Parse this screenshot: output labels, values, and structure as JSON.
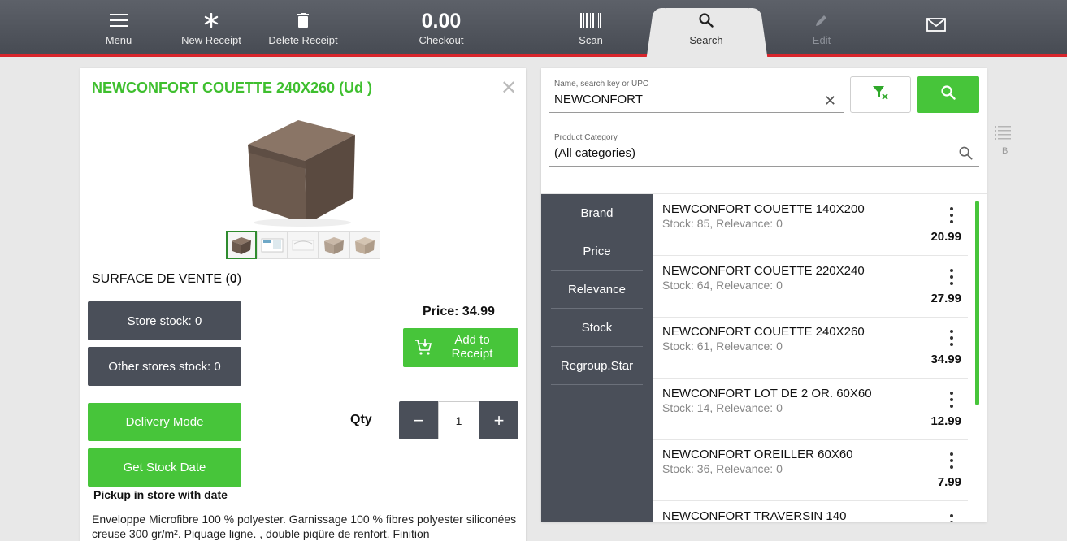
{
  "toolbar": {
    "menu": "Menu",
    "new_receipt": "New Receipt",
    "delete_receipt": "Delete Receipt",
    "checkout_amount": "0.00",
    "checkout": "Checkout",
    "scan": "Scan",
    "search": "Search",
    "edit": "Edit",
    "icons": [
      "menu-icon",
      "asterisk-icon",
      "trash-icon",
      "barcode-icon",
      "search-icon",
      "pencil-icon",
      "mail-icon"
    ],
    "accent_color": "#d8252c"
  },
  "product": {
    "title": "NEWCONFORT COUETTE 240X260 (Ud )",
    "location_label": "SURFACE DE VENTE (",
    "location_count": "0",
    "location_close": ")",
    "store_stock": "Store stock: 0",
    "other_stock": "Other stores stock: 0",
    "price": "Price: 34.99",
    "add_to_receipt": "Add to Receipt",
    "delivery_mode": "Delivery Mode",
    "get_stock_date": "Get Stock Date",
    "pickup_note": "Pickup in store with date",
    "qty_label": "Qty",
    "qty_value": "1",
    "description": "Enveloppe Microfibre 100 % polyester. Garnissage 100 % fibres polyester siliconées creuse 300 gr/m². Piquage ligne. , double piqûre de renfort. Finition",
    "accent_color": "#47c53a"
  },
  "search": {
    "query_label": "Name, search key or UPC",
    "query_value": "NEWCONFORT",
    "category_label": "Product Category",
    "category_value": "(All categories)"
  },
  "sort_options": [
    "Brand",
    "Price",
    "Relevance",
    "Stock",
    "Regroup.Star"
  ],
  "results": [
    {
      "name": "NEWCONFORT COUETTE 140X200",
      "meta": "Stock: 85, Relevance: 0",
      "price": "20.99"
    },
    {
      "name": "NEWCONFORT COUETTE 220X240",
      "meta": "Stock: 64, Relevance: 0",
      "price": "27.99"
    },
    {
      "name": "NEWCONFORT COUETTE 240X260",
      "meta": "Stock: 61, Relevance: 0",
      "price": "34.99"
    },
    {
      "name": "NEWCONFORT LOT DE 2 OR. 60X60",
      "meta": "Stock: 14, Relevance: 0",
      "price": "12.99"
    },
    {
      "name": "NEWCONFORT OREILLER 60X60",
      "meta": "Stock: 36, Relevance: 0",
      "price": "7.99"
    },
    {
      "name": "NEWCONFORT TRAVERSIN 140",
      "meta": "",
      "price": ""
    }
  ],
  "side": {
    "letter": "B"
  }
}
